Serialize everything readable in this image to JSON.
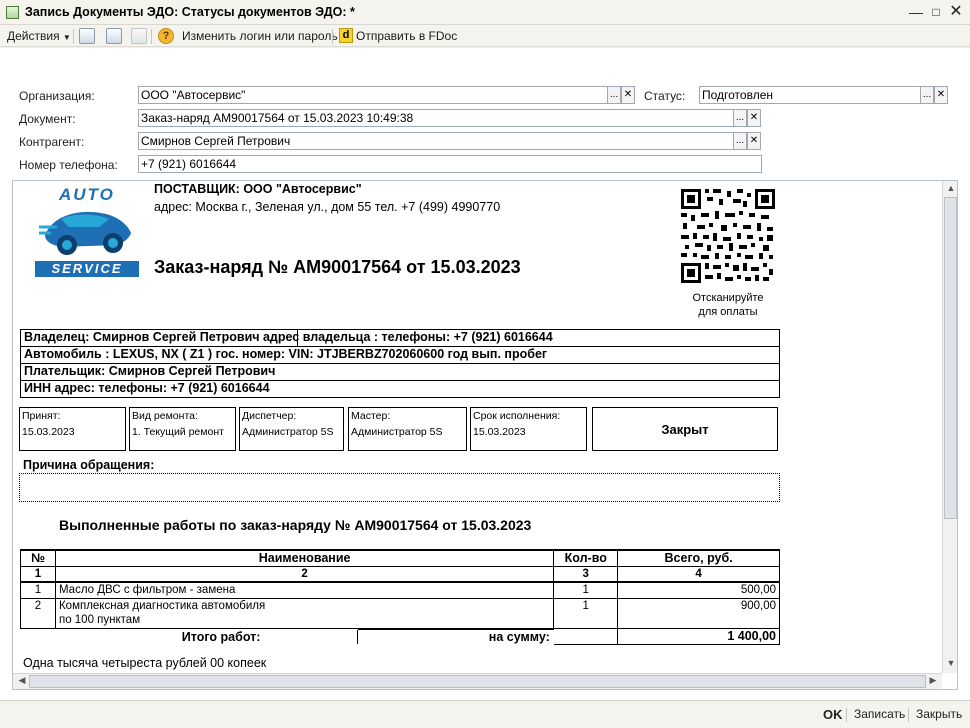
{
  "window": {
    "title": "Запись Документы ЭДО: Статусы документов ЭДО: *"
  },
  "toolbar": {
    "actions_label": "Действия",
    "change_login_label": "Изменить логин или пароль",
    "send_fdoc_label": "Отправить в FDoc"
  },
  "form": {
    "org_label": "Организация:",
    "org_value": "ООО \"Автосервис\"",
    "status_label": "Статус:",
    "status_value": "Подготовлен",
    "doc_label": "Документ:",
    "doc_value": "Заказ-наряд АМ90017564 от 15.03.2023 10:49:38",
    "counterparty_label": "Контрагент:",
    "counterparty_value": "Смирнов Сергей Петрович",
    "phone_label": "Номер телефона:",
    "phone_value": "+7 (921) 6016644"
  },
  "doc": {
    "logo_top": "AUTO",
    "logo_bottom": "SERVICE",
    "supplier": "ПОСТАВЩИК:  ООО \"Автосервис\"",
    "address": "адрес: Москва г., Зеленая ул., дом 55 тел. +7 (499) 4990770",
    "title": "Заказ-наряд № АМ90017564 от 15.03.2023",
    "qr_caption_1": "Отсканируйте",
    "qr_caption_2": "для оплаты",
    "owner_row": "Владелец: Смирнов Сергей Петрович      адрес владельца :    телефоны: +7 (921) 6016644",
    "car_row": "Автомобиль : LEXUS, NX ( Z1 )    гос. номер:     VIN: JTJBERBZ702060600 год вып.  пробег",
    "payer_row": "Плательщик:  Смирнов Сергей Петрович",
    "inn_row": "ИНН     адрес:    телефоны: +7 (921) 6016644",
    "accepted_label": "Принят:",
    "accepted_value": "15.03.2023",
    "repair_label": "Вид ремонта:",
    "repair_value": "1. Текущий ремонт",
    "dispatcher_label": "Диспетчер:",
    "dispatcher_value": "Администратор 5S",
    "master_label": "Мастер:",
    "master_value": "Администратор 5S",
    "deadline_label": "Срок исполнения:",
    "deadline_value": "15.03.2023",
    "state_value": "Закрыт",
    "reason_label": "Причина обращения:",
    "works_title": "Выполненные работы по заказ-наряду №  АМ90017564 от 15.03.2023",
    "table": {
      "headers": [
        "№",
        "Наименование",
        "Кол-во",
        "Всего, руб."
      ],
      "col_numbers": [
        "1",
        "2",
        "3",
        "4"
      ],
      "rows": [
        {
          "n": "1",
          "name": "Масло ДВС с фильтром - замена",
          "qty": "1",
          "total": "500,00"
        },
        {
          "n": "2",
          "name": "Комплексная диагностика автомобиля",
          "name2": "по 100 пунктам",
          "qty": "1",
          "total": "900,00"
        }
      ],
      "total_label": "Итого работ:",
      "sum_label": "на сумму:",
      "sum_value": "1 400,00"
    },
    "amount_words": "Одна тысяча четыреста рублей 00 копеек"
  },
  "footer": {
    "ok_label": "OK",
    "save_label": "Записать",
    "close_label": "Закрыть"
  },
  "colors": {
    "logo_blue": "#1f6fb5",
    "logo_cyan": "#27a7d8"
  },
  "icons": [
    "table-icon",
    "minimize-icon",
    "maximize-icon",
    "close-icon",
    "help-icon",
    "fdoc-icon",
    "dropdown-arrow-icon",
    "select-ellipsis-icon",
    "clear-x-icon",
    "qr-code-icon"
  ]
}
